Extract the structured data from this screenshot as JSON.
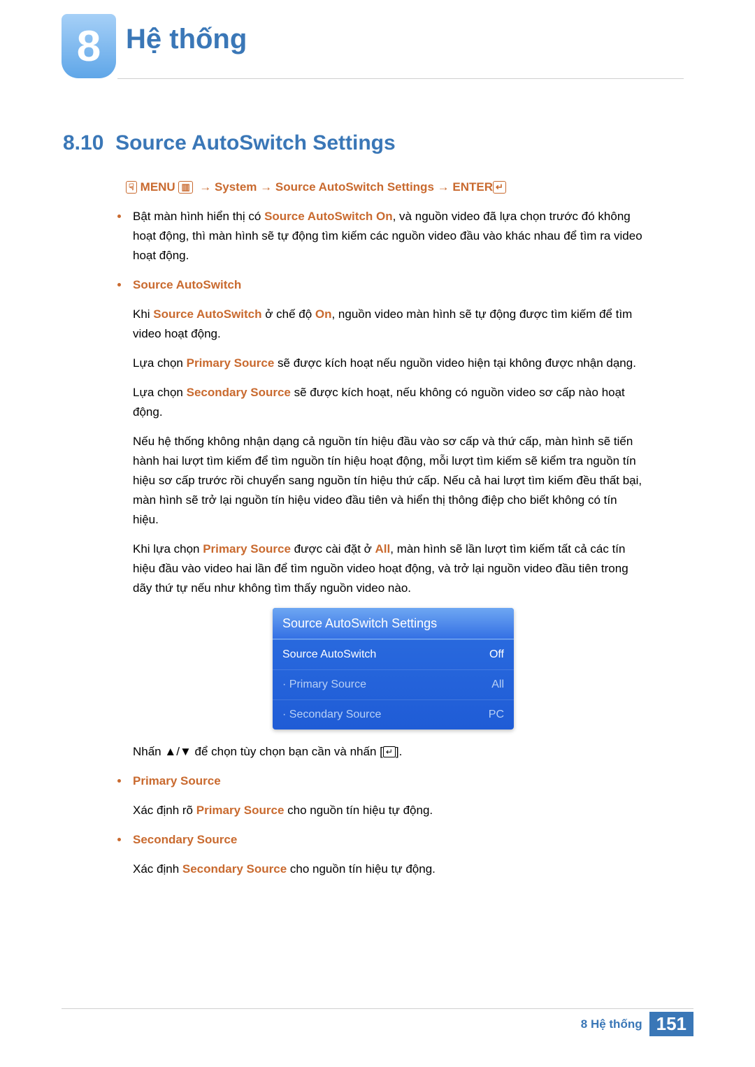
{
  "header": {
    "chapter_number": "8",
    "chapter_title": "Hệ thống"
  },
  "section": {
    "number": "8.10",
    "title": "Source AutoSwitch Settings"
  },
  "nav_path": {
    "hand_icon": "☟",
    "menu": "MENU",
    "menu_icon": "▥",
    "arrow": "→",
    "s1": "System",
    "s2": "Source AutoSwitch Settings",
    "enter": "ENTER",
    "enter_icon": "↵"
  },
  "intro": {
    "p1a": "Bật màn hình hiển thị có ",
    "p1b": "Source AutoSwitch On",
    "p1c": ", và nguồn video đã lựa chọn trước đó không hoạt động, thì màn hình sẽ tự động tìm kiếm các nguồn video đầu vào khác nhau để tìm ra video hoạt động."
  },
  "source_autoswitch": {
    "heading": "Source AutoSwitch",
    "p1a": "Khi ",
    "p1b": "Source AutoSwitch",
    "p1c": " ở chế độ ",
    "p1d": "On",
    "p1e": ", nguồn video màn hình sẽ tự động được tìm kiếm để tìm video hoạt động.",
    "p2a": "Lựa chọn ",
    "p2b": "Primary Source",
    "p2c": " sẽ được kích hoạt nếu nguồn video hiện tại không được nhận dạng.",
    "p3a": "Lựa chọn ",
    "p3b": "Secondary Source",
    "p3c": " sẽ được kích hoạt, nếu không có nguồn video sơ cấp nào hoạt động.",
    "p4": "Nếu hệ thống không nhận dạng cả nguồn tín hiệu đầu vào sơ cấp và thứ cấp, màn hình sẽ tiến hành hai lượt tìm kiếm để tìm nguồn tín hiệu hoạt động, mỗi lượt tìm kiếm sẽ kiểm tra nguồn tín hiệu sơ cấp trước rồi chuyển sang nguồn tín hiệu thứ cấp. Nếu cả hai lượt tìm kiếm đều thất bại, màn hình sẽ trở lại nguồn tín hiệu video đầu tiên và hiển thị thông điệp cho biết không có tín hiệu.",
    "p5a": "Khi lựa chọn ",
    "p5b": "Primary Source",
    "p5c": " được cài đặt ở ",
    "p5d": "All",
    "p5e": ", màn hình sẽ lần lượt tìm kiếm tất cả các tín hiệu đầu vào video hai lần để tìm nguồn video hoạt động, và trở lại nguồn video đầu tiên trong dãy thứ tự nếu như không tìm thấy nguồn video nào."
  },
  "panel": {
    "title": "Source AutoSwitch Settings",
    "rows": [
      {
        "label": "Source AutoSwitch",
        "value": "Off",
        "dim": false
      },
      {
        "label": "· Primary Source",
        "value": "All",
        "dim": true
      },
      {
        "label": "· Secondary Source",
        "value": "PC",
        "dim": true
      }
    ]
  },
  "instruction": {
    "prefix": "Nhấn ",
    "up": "▲",
    "slash": "/",
    "down": "▼",
    "mid": " để chọn tùy chọn bạn cần và nhấn [",
    "enter_icon": "↵",
    "suffix": "]."
  },
  "primary": {
    "heading": "Primary Source",
    "p_a": "Xác định rõ ",
    "p_b": "Primary Source",
    "p_c": " cho nguồn tín hiệu tự động."
  },
  "secondary": {
    "heading": "Secondary Source",
    "p_a": "Xác định ",
    "p_b": "Secondary Source",
    "p_c": " cho nguồn tín hiệu tự động."
  },
  "footer": {
    "chapter": "8 Hệ thống",
    "page": "151"
  }
}
